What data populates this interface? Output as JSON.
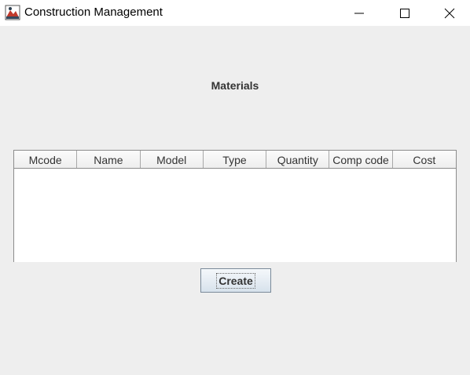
{
  "window": {
    "title": "Construction Management",
    "icon": "app-icon"
  },
  "page": {
    "heading": "Materials"
  },
  "table": {
    "columns": [
      "Mcode",
      "Name",
      "Model",
      "Type",
      "Quantity",
      "Comp code",
      "Cost"
    ],
    "rows": []
  },
  "actions": {
    "create_label": "Create"
  },
  "colors": {
    "background": "#eeeeee",
    "titlebar": "#ffffff",
    "table_body": "#ffffff",
    "button_border": "#7a8a99"
  }
}
